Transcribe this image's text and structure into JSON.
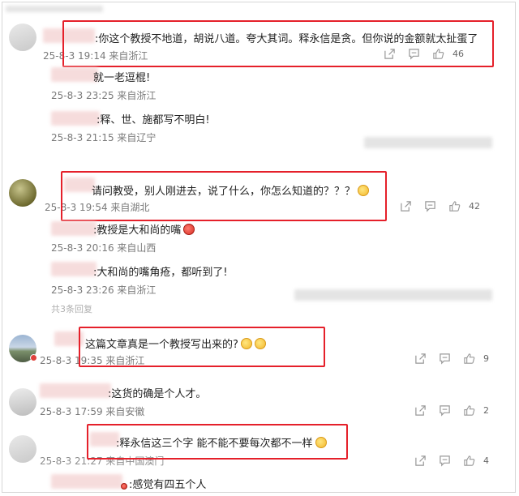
{
  "comments": [
    {
      "text": ":你这个教授不地道，胡说八道。夸大其词。释永信是贪。但你说的金额就太扯蛋了",
      "meta": "25-8-3 19:14 来自浙江",
      "likes": "46",
      "replies": [
        {
          "text": "就一老逗棍!",
          "meta": "25-8-3 23:25 来自浙江"
        },
        {
          "text": ":释、世、施都写不明白!",
          "meta": "25-8-3 21:15 来自辽宁"
        }
      ]
    },
    {
      "text": "请问教受，别人刚进去，说了什么，你怎么知道的？？？",
      "meta": "25-8-3 19:54 来自湖北",
      "likes": "42",
      "replies": [
        {
          "text": ":教授是大和尚的嘴",
          "meta": "25-8-3 20:16 来自山西"
        },
        {
          "text": ":大和尚的嘴角疮，都听到了!",
          "meta": "25-8-3 23:26 来自浙江"
        }
      ],
      "more_replies": "共3条回复"
    },
    {
      "text": "这篇文章真是一个教授写出来的?",
      "meta": "25-8-3 19:35 来自浙江",
      "likes": "9"
    },
    {
      "text": ":这货的确是个人才。",
      "meta": "25-8-3 17:59 来自安徽",
      "likes": "2"
    },
    {
      "text": ":释永信这三个字 能不能不要每次都不一样",
      "meta": "25-8-3 21:27 来自中国澳门",
      "likes": "4"
    },
    {
      "text": ":感觉有四五个人",
      "meta": ""
    }
  ],
  "colors": {
    "highlight_box": "#e5202a",
    "meta_text": "#7a7a7a",
    "background": "#ffffff"
  },
  "icons": [
    "share-icon",
    "comment-icon",
    "like-icon"
  ]
}
